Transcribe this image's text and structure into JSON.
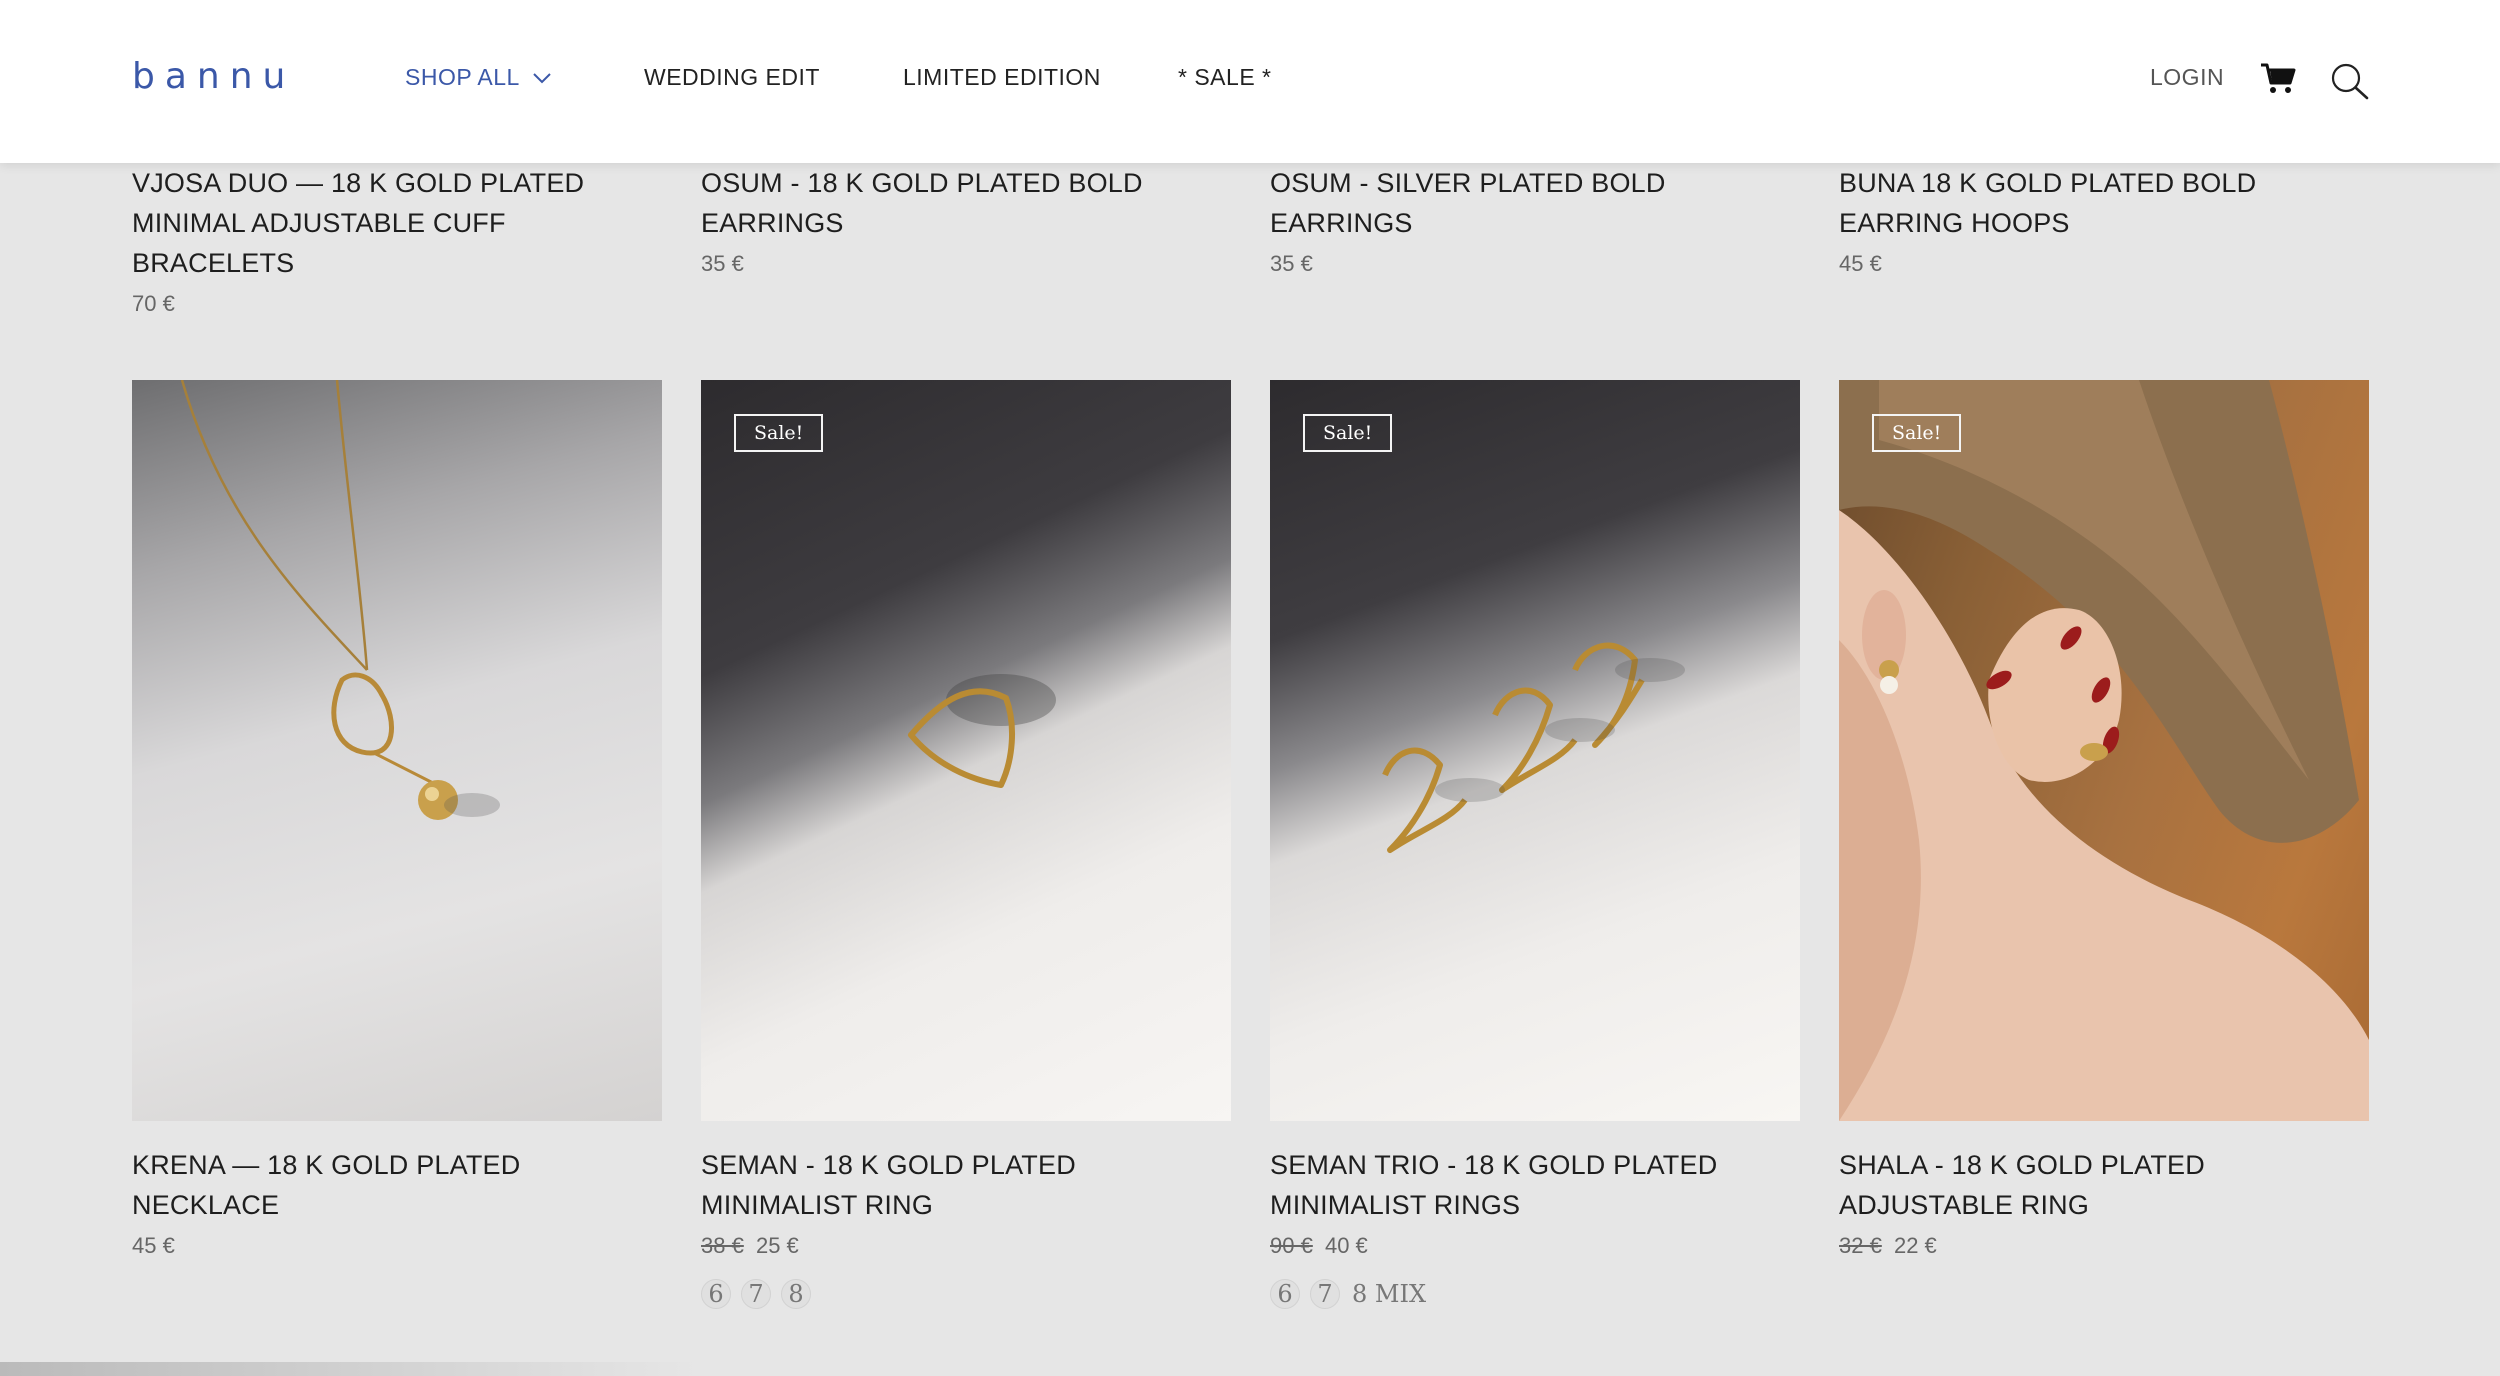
{
  "header": {
    "logo": "bannu",
    "nav": [
      {
        "label": "SHOP ALL"
      },
      {
        "label": "WEDDING EDIT"
      },
      {
        "label": "LIMITED EDITION"
      },
      {
        "label": "* SALE *"
      }
    ],
    "login_label": "LOGIN",
    "accent_color": "#3b58a8"
  },
  "top_products": [
    {
      "title": "VJOSA DUO — 18 K GOLD PLATED MINIMAL ADJUSTABLE CUFF BRACELETS",
      "price": "70 €"
    },
    {
      "title": "OSUM - 18 K GOLD PLATED BOLD EARRINGS",
      "price": "35 €"
    },
    {
      "title": "OSUM - SILVER PLATED BOLD EARRINGS",
      "price": "35 €"
    },
    {
      "title": "BUNA 18 K GOLD PLATED BOLD EARRING HOOPS",
      "price": "45 €"
    }
  ],
  "products": [
    {
      "title": "KRENA — 18 K GOLD PLATED NECKLACE",
      "price": "45 €",
      "old_price": "",
      "badge": ""
    },
    {
      "title": "SEMAN - 18 K GOLD PLATED MINIMALIST RING",
      "old_price": "38 €",
      "price": "25 €",
      "badge": "Sale!",
      "sizes": [
        "6",
        "7",
        "8"
      ]
    },
    {
      "title": "SEMAN TRIO - 18 K GOLD PLATED MINIMALIST RINGS",
      "old_price": "90 €",
      "price": "40 €",
      "badge": "Sale!",
      "sizes": [
        "6",
        "7",
        "8 MIX"
      ]
    },
    {
      "title": "SHALA - 18 K GOLD PLATED ADJUSTABLE RING",
      "old_price": "32 €",
      "price": "22 €",
      "badge": "Sale!"
    }
  ],
  "icons": [
    "chevron-down-icon",
    "cart-icon",
    "search-icon"
  ]
}
